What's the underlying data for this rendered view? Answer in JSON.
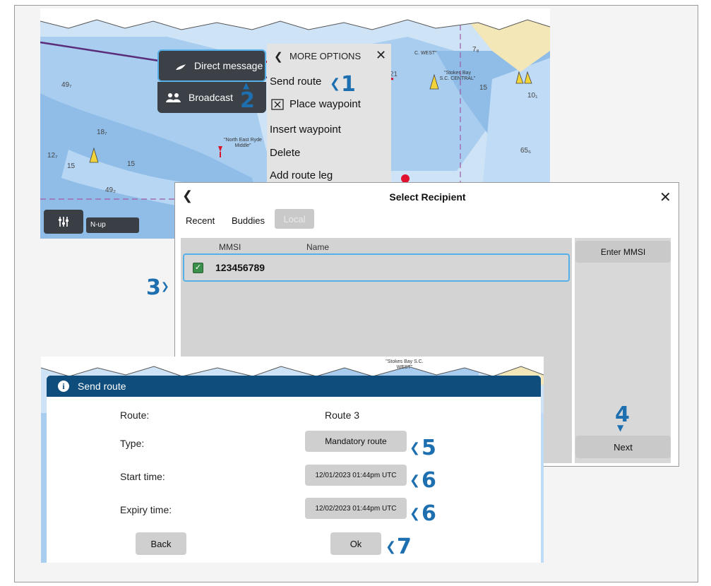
{
  "chart1": {
    "view_label": "N-up",
    "labels": {
      "stokes_west": "C. WEST\"",
      "stokes_central": "\"Stokes Bay S.C. CENTRAL\"",
      "north_east": "\"North East Ryde Middle\"",
      "d_49a": "49₇",
      "d_49b": "49₂",
      "d_18": "18₇",
      "d_12": "12₇",
      "d_15a": "15",
      "d_15b": "15",
      "d_15c": "15",
      "d_10": "10₁",
      "d_65": "65₆",
      "d_7": "7₈",
      "d_21": "21"
    }
  },
  "popup": {
    "direct_message": "Direct message",
    "broadcast": "Broadcast"
  },
  "menu": {
    "title": "MORE OPTIONS",
    "items": [
      "Send route",
      "Place waypoint",
      "Insert waypoint",
      "Delete",
      "Add route leg"
    ]
  },
  "recipient": {
    "title": "Select Recipient",
    "tabs": [
      "Recent",
      "Buddies",
      "Local"
    ],
    "columns": {
      "mmsi": "MMSI",
      "name": "Name"
    },
    "rows": [
      {
        "mmsi": "123456789",
        "name": "",
        "checked": true
      }
    ],
    "enter_mmsi": "Enter MMSI",
    "next": "Next"
  },
  "chart2": {
    "label": "\"Stokes Bay S.C. WEST\""
  },
  "send_route": {
    "title": "Send route",
    "labels": {
      "route": "Route:",
      "type": "Type:",
      "start": "Start time:",
      "expiry": "Expiry time:"
    },
    "route_value": "Route 3",
    "type_value": "Mandatory route",
    "start_value": "12/01/2023 01:44pm UTC",
    "expiry_value": "12/02/2023 01:44pm UTC",
    "back": "Back",
    "ok": "Ok"
  },
  "callouts": [
    "1",
    "2",
    "3",
    "4",
    "5",
    "6",
    "6",
    "7"
  ],
  "colors": {
    "callout": "#1d6fb0",
    "dialog_header": "#0f4e7c",
    "deep_water": "#9fc5ea",
    "shallow_water": "#cfe3f6",
    "land": "#f3e7b8"
  }
}
